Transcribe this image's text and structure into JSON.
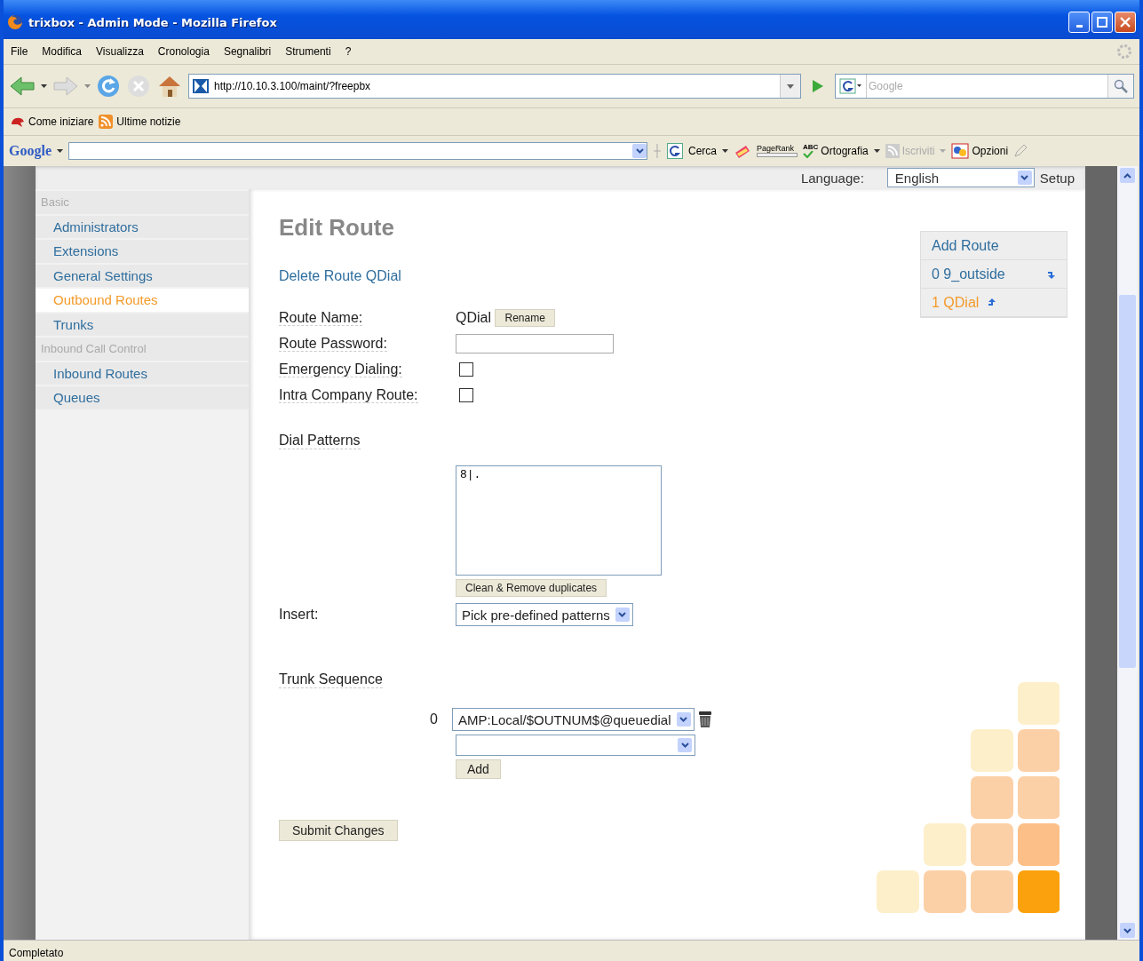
{
  "window": {
    "title": "trixbox - Admin Mode - Mozilla Firefox"
  },
  "menu": [
    "File",
    "Modifica",
    "Visualizza",
    "Cronologia",
    "Segnalibri",
    "Strumenti",
    "?"
  ],
  "address_bar": {
    "url": "http://10.10.3.100/maint/?freepbx"
  },
  "search": {
    "placeholder": "Google"
  },
  "bookmarks": [
    "Come iniziare",
    "Ultime notizie"
  ],
  "google_toolbar": {
    "logo": "Google",
    "items": [
      {
        "kind": "button",
        "label": "Cerca",
        "disabled": false
      },
      {
        "kind": "pagerank",
        "label": "PageRank",
        "disabled": false
      },
      {
        "kind": "spell",
        "icon_text": "ABC",
        "label": "Ortografia",
        "disabled": false
      },
      {
        "kind": "feed",
        "label": "Iscriviti",
        "disabled": true
      },
      {
        "kind": "options",
        "label": "Opzioni",
        "disabled": false
      }
    ]
  },
  "page_header": {
    "language_label": "Language:",
    "language": "English",
    "setup": "Setup"
  },
  "sidebar": {
    "items": [
      {
        "kind": "section",
        "label": "Basic",
        "selected": false
      },
      {
        "kind": "link",
        "label": "Administrators",
        "selected": false
      },
      {
        "kind": "link",
        "label": "Extensions",
        "selected": false
      },
      {
        "kind": "link",
        "label": "General Settings",
        "selected": false
      },
      {
        "kind": "link",
        "label": "Outbound Routes",
        "selected": true
      },
      {
        "kind": "link",
        "label": "Trunks",
        "selected": false
      },
      {
        "kind": "section",
        "label": "Inbound Call Control",
        "selected": false
      },
      {
        "kind": "link",
        "label": "Inbound Routes",
        "selected": false
      },
      {
        "kind": "link",
        "label": "Queues",
        "selected": false
      }
    ]
  },
  "heading": "Edit Route",
  "delete_link": "Delete Route QDial",
  "form": [
    {
      "kind": "text",
      "label": "Route Name:",
      "value": "QDial",
      "button": "Rename"
    },
    {
      "kind": "input",
      "label": "Route Password:"
    },
    {
      "kind": "checkbox",
      "label": "Emergency Dialing:",
      "checked": false
    },
    {
      "kind": "checkbox",
      "label": "Intra Company Route:",
      "checked": false
    }
  ],
  "dial_patterns": {
    "title": "Dial Patterns",
    "value": "8|.",
    "clean_button": "Clean & Remove duplicates",
    "insert_label": "Insert:",
    "insert_value": "Pick pre-defined patterns"
  },
  "trunk_sequence": {
    "title": "Trunk Sequence",
    "trunks": [
      {
        "order": "0",
        "value": "AMP:Local/$OUTNUM$@queuedial"
      }
    ],
    "add_button": "Add"
  },
  "submit": "Submit Changes",
  "routes": [
    {
      "kind": "add",
      "label": "Add Route",
      "selected": false
    },
    {
      "kind": "move_down",
      "label": "0 9_outside",
      "selected": false
    },
    {
      "kind": "move_up",
      "label": "1 QDial",
      "selected": true
    }
  ],
  "status_bar": {
    "text": "Completato"
  }
}
